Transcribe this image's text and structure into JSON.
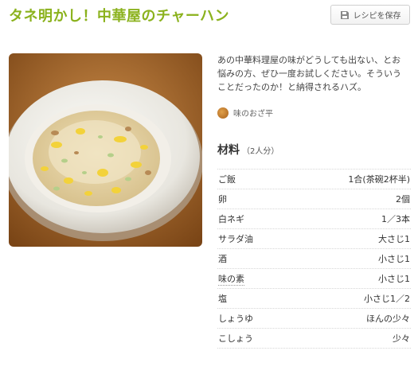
{
  "recipe": {
    "title": "タネ明かし！中華屋のチャーハン",
    "description": "あの中華料理屋の味がどうしても出ない、とお悩みの方、ぜひ一度お試しください。そういうことだったのか！と納得されるハズ。",
    "author": "味のおざ平"
  },
  "actions": {
    "save_label": "レシピを保存"
  },
  "ingredients": {
    "heading": "材料",
    "servings": "（2人分）",
    "items": [
      {
        "name": "ご飯",
        "amount": "1合(茶碗2杯半)"
      },
      {
        "name": "卵",
        "amount": "2個"
      },
      {
        "name": "白ネギ",
        "amount": "1／3本"
      },
      {
        "name": "サラダ油",
        "amount": "大さじ1"
      },
      {
        "name": "酒",
        "amount": "小さじ1"
      },
      {
        "name": "味の素",
        "amount": "小さじ1"
      },
      {
        "name": "塩",
        "amount": "小さじ1／2"
      },
      {
        "name": "しょうゆ",
        "amount": "ほんの少々"
      },
      {
        "name": "こしょう",
        "amount": "少々"
      }
    ]
  },
  "icons": {
    "save": "save-icon",
    "avatar": "avatar"
  },
  "colors": {
    "title": "#8bb21d"
  }
}
